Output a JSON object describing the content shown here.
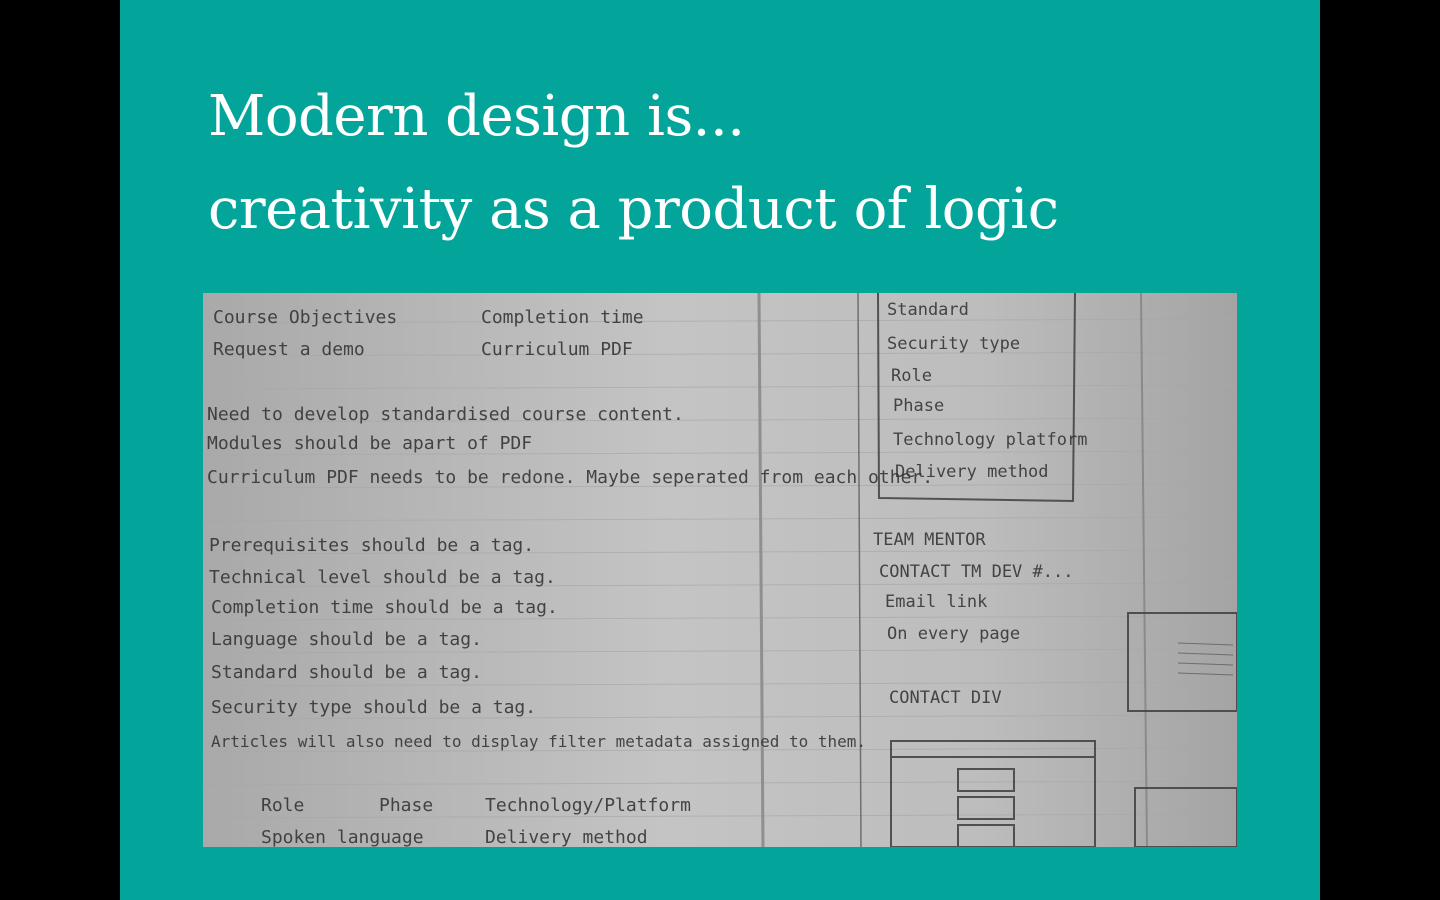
{
  "slide": {
    "background_color": "#03a59b",
    "title_lines": [
      "Modern design is...",
      "creativity as a product of logic"
    ]
  },
  "photo": {
    "handwritten_notes_left": [
      "Course Objectives",
      "Request a demo",
      "Completion time",
      "Curriculum PDF",
      "Need to develop standardised course content.",
      "Modules should be apart of PDF",
      "Curriculum PDF needs to be redone. Maybe seperated from each other.",
      "Prerequisites should be a tag.",
      "Technical level should be a tag.",
      "Completion time should be a tag.",
      "Language should be a tag.",
      "Standard should be a tag.",
      "Security type should be a tag.",
      "Articles will also need to display filter metadata assigned to them.",
      "Role",
      "Phase",
      "Technology/Platform",
      "Spoken language",
      "Delivery method"
    ],
    "handwritten_notes_right": [
      "Standard",
      "Security type",
      "Role",
      "Phase",
      "Technology platform",
      "Delivery method",
      "TEAM MENTOR",
      "CONTACT TM DEV #...",
      "Email link",
      "On every page",
      "CONTACT DIV"
    ]
  }
}
